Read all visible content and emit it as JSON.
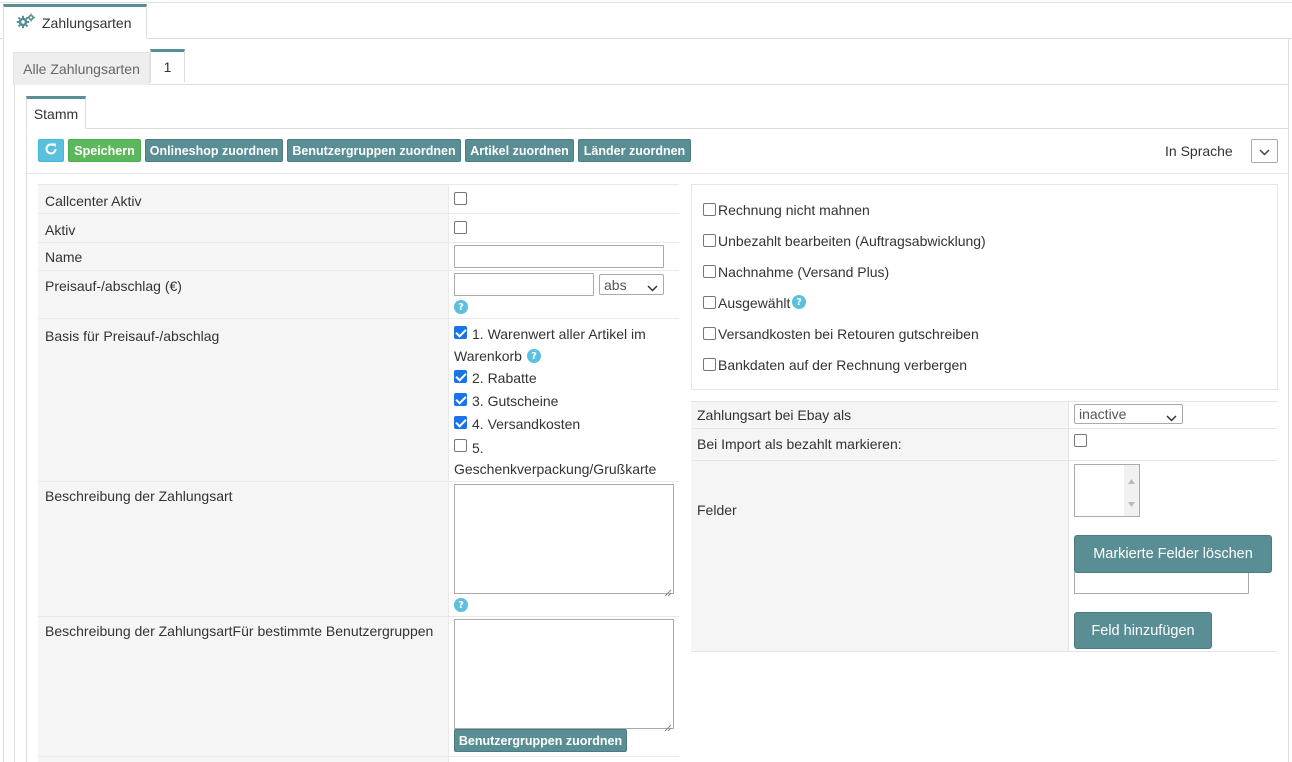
{
  "main_tab": {
    "label": "Zahlungsarten",
    "icon": "gears-icon"
  },
  "sub_tabs": [
    {
      "label": "Alle Zahlungsarten"
    },
    {
      "label": "1"
    }
  ],
  "inner_tab": {
    "label": "Stamm"
  },
  "toolbar": {
    "refresh_icon": "refresh-icon",
    "save_label": "Speichern",
    "onlineshop_label": "Onlineshop zuordnen",
    "usergroups_label": "Benutzergruppen zuordnen",
    "articles_label": "Artikel zuordnen",
    "countries_label": "Länder zuordnen",
    "language_label": "In Sprache"
  },
  "form": {
    "callcenter_label": "Callcenter Aktiv",
    "callcenter_checked": false,
    "aktiv_label": "Aktiv",
    "aktiv_checked": false,
    "name_label": "Name",
    "name_value": "",
    "price_label": "Preisauf-/abschlag (€)",
    "price_value": "",
    "price_mode": "abs",
    "basis_label": "Basis für Preisauf-/abschlag",
    "basis_items": [
      {
        "label_line1": "1. Warenwert aller Artikel im",
        "label_line2": "Warenkorb",
        "checked": true
      },
      {
        "label": "2. Rabatte",
        "checked": true
      },
      {
        "label": "3. Gutscheine",
        "checked": true
      },
      {
        "label": "4. Versandkosten",
        "checked": true
      },
      {
        "label_line1": "5.",
        "label_line2": "Geschenkverpackung/Grußkarte",
        "checked": false
      }
    ],
    "description_label": "Beschreibung der Zahlungsart",
    "description_value": "",
    "description_groups_label": "Beschreibung der ZahlungsartFür bestimmte Benutzergruppen",
    "description_groups_value": "",
    "assign_groups_label": "Benutzergruppen zuordnen"
  },
  "options": [
    {
      "label": "Rechnung nicht mahnen",
      "checked": false
    },
    {
      "label": "Unbezahlt bearbeiten (Auftragsabwicklung)",
      "checked": false
    },
    {
      "label": "Nachnahme (Versand Plus)",
      "checked": false
    },
    {
      "label": "Ausgewählt",
      "checked": false
    },
    {
      "label": "Versandkosten bei Retouren gutschreiben",
      "checked": false
    },
    {
      "label": "Bankdaten auf der Rechnung verbergen",
      "checked": false
    }
  ],
  "ebay": {
    "ebay_label": "Zahlungsart bei Ebay als",
    "ebay_value": "inactive",
    "import_paid_label": "Bei Import als bezahlt markieren:",
    "import_paid_checked": false,
    "fields_label": "Felder",
    "delete_fields_label": "Markierte Felder löschen",
    "new_field_value": "",
    "add_field_label": "Feld hinzufügen"
  },
  "colors": {
    "teal": "#5a8e95",
    "green": "#5cb85c",
    "info": "#5bc0de"
  }
}
